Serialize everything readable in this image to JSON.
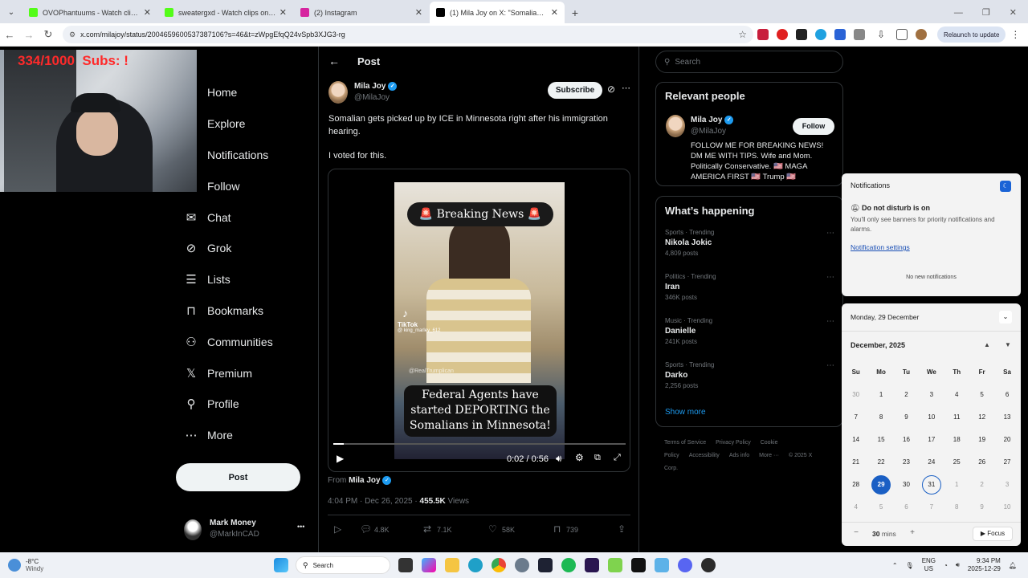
{
  "browser": {
    "tabs": [
      {
        "label": "OVOPhantuums - Watch clips o",
        "icon_color": "#53fc18",
        "active": false
      },
      {
        "label": "sweatergxd - Watch clips on Ki",
        "icon_color": "#53fc18",
        "active": false
      },
      {
        "label": "(2) Instagram",
        "icon_color": "#d6249f",
        "active": false
      },
      {
        "label": "(1) Mila Joy on X: \"Somalian ge",
        "icon_color": "#000000",
        "active": true
      }
    ],
    "new_tab": "+",
    "url": "x.com/milajoy/status/2004659600537387106?s=46&t=zWpgEfqQ24vSpb3XJG3-rg",
    "relaunch_label": "Relaunch to update"
  },
  "stream_overlay": {
    "sub_goal": "334/1000  Subs: !"
  },
  "nav": {
    "items": [
      {
        "label": "Home",
        "icon": "home-icon",
        "glyph": ""
      },
      {
        "label": "Explore",
        "icon": "search-icon",
        "glyph": ""
      },
      {
        "label": "Notifications",
        "icon": "bell-icon",
        "glyph": ""
      },
      {
        "label": "Follow",
        "icon": "follow-icon",
        "glyph": ""
      },
      {
        "label": "Chat",
        "icon": "mail-icon",
        "glyph": "✉"
      },
      {
        "label": "Grok",
        "icon": "grok-icon",
        "glyph": "⊘"
      },
      {
        "label": "Lists",
        "icon": "list-icon",
        "glyph": "☰"
      },
      {
        "label": "Bookmarks",
        "icon": "bookmark-icon",
        "glyph": "⊓"
      },
      {
        "label": "Communities",
        "icon": "communities-icon",
        "glyph": "⚇"
      },
      {
        "label": "Premium",
        "icon": "x-logo-icon",
        "glyph": "𝕏"
      },
      {
        "label": "Profile",
        "icon": "profile-icon",
        "glyph": "⚲"
      },
      {
        "label": "More",
        "icon": "more-icon",
        "glyph": "⋯"
      }
    ],
    "post_button": "Post",
    "account": {
      "name": "Mark Money",
      "handle": "@MarkInCAD",
      "more": "•••"
    }
  },
  "post": {
    "header_title": "Post",
    "author_name": "Mila Joy",
    "author_handle": "@MilaJoy",
    "subscribe_label": "Subscribe",
    "text1": "Somalian gets picked up by ICE in Minnesota right after his immigration hearing.",
    "text2": "I voted for this.",
    "video": {
      "banner": "🚨 Breaking News 🚨",
      "caption": "Federal Agents have started DEPORTING the Somalians in Minnesota!",
      "tiktok_label": "TikTok",
      "tiktok_handle": "@ king_marley_612",
      "watermark": "@RealTrumplican",
      "time": "0:02 / 0:56",
      "progress": 0.036
    },
    "from_label": "From",
    "from_name": "Mila Joy",
    "meta": "4:04 PM · Dec 26, 2025 · ",
    "views_count": "455.5K",
    "views_label": " Views",
    "stats": {
      "replies": "4.8K",
      "reposts": "7.1K",
      "likes": "58K",
      "bookmarks": "739"
    }
  },
  "sidebar": {
    "search_placeholder": "Search",
    "relevant_title": "Relevant people",
    "person": {
      "name": "Mila Joy",
      "handle": "@MilaJoy",
      "follow_label": "Follow",
      "bio": "FOLLOW ME FOR BREAKING NEWS! DM ME WITH TIPS. Wife and Mom. Politically Conservative. 🇺🇸 MAGA AMERICA FIRST 🇺🇸 Trump 🇺🇸"
    },
    "happening_title": "What’s happening",
    "trends": [
      {
        "context": "Sports · Trending",
        "name": "Nikola Jokic",
        "posts": "4,809 posts"
      },
      {
        "context": "Politics · Trending",
        "name": "Iran",
        "posts": "346K posts"
      },
      {
        "context": "Music · Trending",
        "name": "Danielle",
        "posts": "241K posts"
      },
      {
        "context": "Sports · Trending",
        "name": "Darko",
        "posts": "2,256 posts"
      }
    ],
    "show_more": "Show more",
    "footer": [
      "Terms of Service",
      "Privacy Policy",
      "Cookie Policy",
      "Accessibility",
      "Ads info",
      "More ···",
      "© 2025 X Corp."
    ]
  },
  "notifications": {
    "title": "Notifications",
    "dnd_title": "Do not disturb is on",
    "dnd_body": "You'll only see banners for priority notifications and alarms.",
    "settings_link": "Notification settings",
    "empty": "No new notifications"
  },
  "calendar": {
    "date_header": "Monday, 29 December",
    "month": "December, 2025",
    "weekdays": [
      "Su",
      "Mo",
      "Tu",
      "We",
      "Th",
      "Fr",
      "Sa"
    ],
    "days": [
      "30",
      "1",
      "2",
      "3",
      "4",
      "5",
      "6",
      "7",
      "8",
      "9",
      "10",
      "11",
      "12",
      "13",
      "14",
      "15",
      "16",
      "17",
      "18",
      "19",
      "20",
      "21",
      "22",
      "23",
      "24",
      "25",
      "26",
      "27",
      "28",
      "29",
      "30",
      "31",
      "1",
      "2",
      "3",
      "4",
      "5",
      "6",
      "7",
      "8",
      "9",
      "10"
    ],
    "today": "29",
    "focus_minutes": "30",
    "focus_unit": "mins",
    "focus_label": "Focus"
  },
  "taskbar": {
    "weather_temp": "-8°C",
    "weather_desc": "Windy",
    "search_label": "Search",
    "lang": "ENG",
    "region": "US",
    "time": "9:34 PM",
    "date": "2025-12-29"
  }
}
